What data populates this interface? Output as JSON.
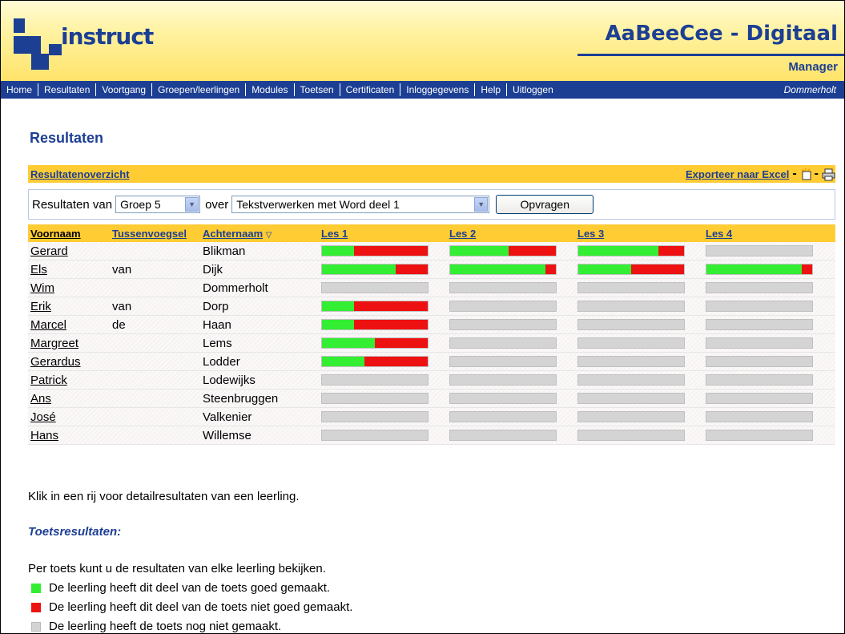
{
  "header": {
    "logo_text": "instruct",
    "app_title": "AaBeeCee - Digitaal",
    "app_subtitle": "Manager",
    "logo_color": "#1c3f94"
  },
  "nav": {
    "items": [
      "Home",
      "Resultaten",
      "Voortgang",
      "Groepen/leerlingen",
      "Modules",
      "Toetsen",
      "Certificaten",
      "Inloggegevens",
      "Help",
      "Uitloggen"
    ],
    "user": "Dommerholt"
  },
  "page_title": "Resultaten",
  "panel": {
    "overview_link": "Resultatenoverzicht",
    "export_link": "Exporteer naar Excel",
    "icons": [
      "new-window-icon",
      "print-icon"
    ]
  },
  "filter": {
    "label_from": "Resultaten van",
    "group_value": "Groep 5",
    "label_over": "over",
    "module_value": "Tekstverwerken met Word deel 1",
    "submit_label": "Opvragen"
  },
  "table": {
    "headers": {
      "first": "Voornaam",
      "middle": "Tussenvoegsel",
      "last": "Achternaam",
      "sort_icon": "▽",
      "lessons": [
        "Les 1",
        "Les 2",
        "Les 3",
        "Les 4"
      ]
    },
    "rows": [
      {
        "first": "Gerard",
        "middle": "",
        "last": "Blikman",
        "lessons": [
          [
            0.3,
            0.7
          ],
          [
            0.55,
            0.45
          ],
          [
            0.76,
            0.24
          ],
          [
            0,
            0
          ]
        ]
      },
      {
        "first": "Els",
        "middle": "van",
        "last": "Dijk",
        "lessons": [
          [
            0.7,
            0.3
          ],
          [
            0.9,
            0.1
          ],
          [
            0.5,
            0.5
          ],
          [
            0.9,
            0.1
          ]
        ]
      },
      {
        "first": "Wim",
        "middle": "",
        "last": "Dommerholt",
        "lessons": [
          [
            0,
            0
          ],
          [
            0,
            0
          ],
          [
            0,
            0
          ],
          [
            0,
            0
          ]
        ]
      },
      {
        "first": "Erik",
        "middle": "van",
        "last": "Dorp",
        "lessons": [
          [
            0.3,
            0.7
          ],
          [
            0,
            0
          ],
          [
            0,
            0
          ],
          [
            0,
            0
          ]
        ]
      },
      {
        "first": "Marcel",
        "middle": "de",
        "last": "Haan",
        "lessons": [
          [
            0.3,
            0.7
          ],
          [
            0,
            0
          ],
          [
            0,
            0
          ],
          [
            0,
            0
          ]
        ]
      },
      {
        "first": "Margreet",
        "middle": "",
        "last": "Lems",
        "lessons": [
          [
            0.5,
            0.5
          ],
          [
            0,
            0
          ],
          [
            0,
            0
          ],
          [
            0,
            0
          ]
        ]
      },
      {
        "first": "Gerardus",
        "middle": "",
        "last": "Lodder",
        "lessons": [
          [
            0.4,
            0.6
          ],
          [
            0,
            0
          ],
          [
            0,
            0
          ],
          [
            0,
            0
          ]
        ]
      },
      {
        "first": "Patrick",
        "middle": "",
        "last": "Lodewijks",
        "lessons": [
          [
            0,
            0
          ],
          [
            0,
            0
          ],
          [
            0,
            0
          ],
          [
            0,
            0
          ]
        ]
      },
      {
        "first": "Ans",
        "middle": "",
        "last": "Steenbruggen",
        "lessons": [
          [
            0,
            0
          ],
          [
            0,
            0
          ],
          [
            0,
            0
          ],
          [
            0,
            0
          ]
        ]
      },
      {
        "first": "José",
        "middle": "",
        "last": "Valkenier",
        "lessons": [
          [
            0,
            0
          ],
          [
            0,
            0
          ],
          [
            0,
            0
          ],
          [
            0,
            0
          ]
        ]
      },
      {
        "first": "Hans",
        "middle": "",
        "last": "Willemse",
        "lessons": [
          [
            0,
            0
          ],
          [
            0,
            0
          ],
          [
            0,
            0
          ],
          [
            0,
            0
          ]
        ]
      }
    ]
  },
  "hint": "Klik in een rij voor detailresultaten van een leerling.",
  "toets_heading": "Toetsresultaten:",
  "per_toets": "Per toets kunt u de resultaten van elke leerling bekijken.",
  "legend": [
    {
      "color": "#33ee33",
      "text": "De leerling heeft dit deel van de toets goed gemaakt."
    },
    {
      "color": "#ee1111",
      "text": "De leerling heeft dit deel van de toets niet goed gemaakt."
    },
    {
      "color": "#d4d4d4",
      "text": "De leerling heeft de toets nog niet gemaakt."
    }
  ],
  "colors": {
    "nav": "#1c3f94",
    "accent": "#ffcc33",
    "correct": "#33ee33",
    "wrong": "#ee1111",
    "not_done": "#d4d4d4"
  }
}
